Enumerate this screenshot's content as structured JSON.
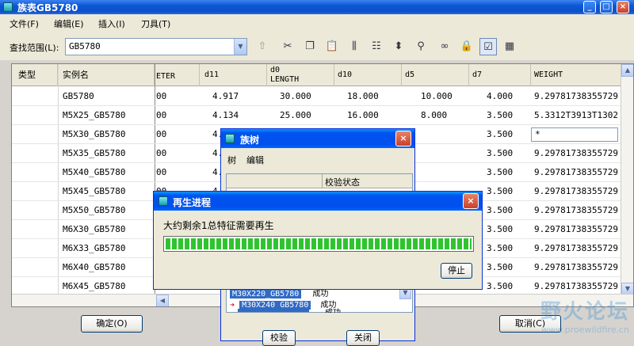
{
  "window": {
    "title": "族表GB5780",
    "controls": {
      "minimize": "_",
      "maximize": "□",
      "close": "×"
    }
  },
  "menu": [
    "文件(F)",
    "编辑(E)",
    "插入(I)",
    "刀具(T)"
  ],
  "search": {
    "label": "查找范围(L):",
    "value": "GB5780"
  },
  "toolbar": {
    "icons": [
      "up-folder-icon",
      "cut-icon",
      "copy-icon",
      "paste-icon",
      "insert-column-icon",
      "insert-row-icon",
      "column-width-icon",
      "binoculars-icon",
      "glasses-icon",
      "lock-icon",
      "verify-icon",
      "table-icon"
    ],
    "glyphs": [
      "⇧",
      "✂",
      "❐",
      "📋",
      "⫼",
      "☷",
      "⬍",
      "⚲",
      "∞",
      "🔒",
      "☑",
      "▦"
    ]
  },
  "table": {
    "headers": {
      "type": "类型",
      "instance": "实例名",
      "diameter": "ETER",
      "d11": "d11",
      "d0_line1": "d0",
      "d0_line2": "LENGTH",
      "d10": "d10",
      "d5": "d5",
      "d7": "d7",
      "weight": "WEIGHT"
    },
    "rows": [
      {
        "instance": "GB5780",
        "diameter": "00",
        "d11": "4.917",
        "d0": "30.000",
        "d10": "18.000",
        "d5": "10.000",
        "d7": "4.000",
        "weight": "9.29781738355729"
      },
      {
        "instance": "M5X25_GB5780",
        "diameter": "00",
        "d11": "4.134",
        "d0": "25.000",
        "d10": "16.000",
        "d5": "8.000",
        "d7": "3.500",
        "weight": "5.3312T3913T1302"
      },
      {
        "instance": "M5X30_GB5780",
        "diameter": "00",
        "d11": "4.",
        "d0": "",
        "d10": "",
        "d5": "",
        "d7": "3.500",
        "weight": "*"
      },
      {
        "instance": "M5X35_GB5780",
        "diameter": "00",
        "d11": "4.",
        "d0": "",
        "d10": "",
        "d5": "",
        "d7": "3.500",
        "weight": "9.29781738355729"
      },
      {
        "instance": "M5X40_GB5780",
        "diameter": "00",
        "d11": "4.",
        "d0": "",
        "d10": "",
        "d5": "",
        "d7": "3.500",
        "weight": "9.29781738355729"
      },
      {
        "instance": "M5X45_GB5780",
        "diameter": "00",
        "d11": "4.",
        "d0": "",
        "d10": "",
        "d5": "",
        "d7": "3.500",
        "weight": "9.29781738355729"
      },
      {
        "instance": "M5X50_GB5780",
        "diameter": "00",
        "d11": "",
        "d0": "",
        "d10": "",
        "d5": "",
        "d7": "3.500",
        "weight": "9.29781738355729"
      },
      {
        "instance": "M6X30_GB5780",
        "diameter": "00",
        "d11": "",
        "d0": "",
        "d10": "",
        "d5": "",
        "d7": "3.500",
        "weight": "9.29781738355729"
      },
      {
        "instance": "M6X33_GB5780",
        "diameter": "00",
        "d11": "",
        "d0": "",
        "d10": "",
        "d5": "",
        "d7": "3.500",
        "weight": "9.29781738355729"
      },
      {
        "instance": "M6X40_GB5780",
        "diameter": "00",
        "d11": "",
        "d0": "",
        "d10": "",
        "d5": "",
        "d7": "3.500",
        "weight": "9.29781738355729"
      },
      {
        "instance": "M6X45_GB5780",
        "diameter": "00",
        "d11": "",
        "d0": "",
        "d10": "",
        "d5": "",
        "d7": "3.500",
        "weight": "9.29781738355729"
      },
      {
        "instance": "M6X50_GB5780",
        "diameter": "00",
        "d11": "",
        "d0": "",
        "d10": "",
        "d5": "",
        "d7": "3.500",
        "weight": "9.29781738355729"
      }
    ]
  },
  "buttons": {
    "ok": "确定(O)",
    "cancel": "取消(C)"
  },
  "family_tree": {
    "title": "族树",
    "menu": [
      "树",
      "编辑"
    ],
    "column_header": "校验状态",
    "items": [
      {
        "name": "M30X220_GB5780",
        "status": "成功"
      },
      {
        "name": "M30X240_GB5780",
        "status": "成功"
      },
      {
        "name": "",
        "status": "成功"
      }
    ],
    "verify_button": "校验",
    "close_button": "关闭"
  },
  "regen": {
    "title": "再生进程",
    "message": "大约剩余1总特征需要再生",
    "progress": 1.0,
    "stop_button": "停止"
  },
  "watermark": {
    "text": "野火论坛",
    "url": "www.proewildfire.cn"
  }
}
